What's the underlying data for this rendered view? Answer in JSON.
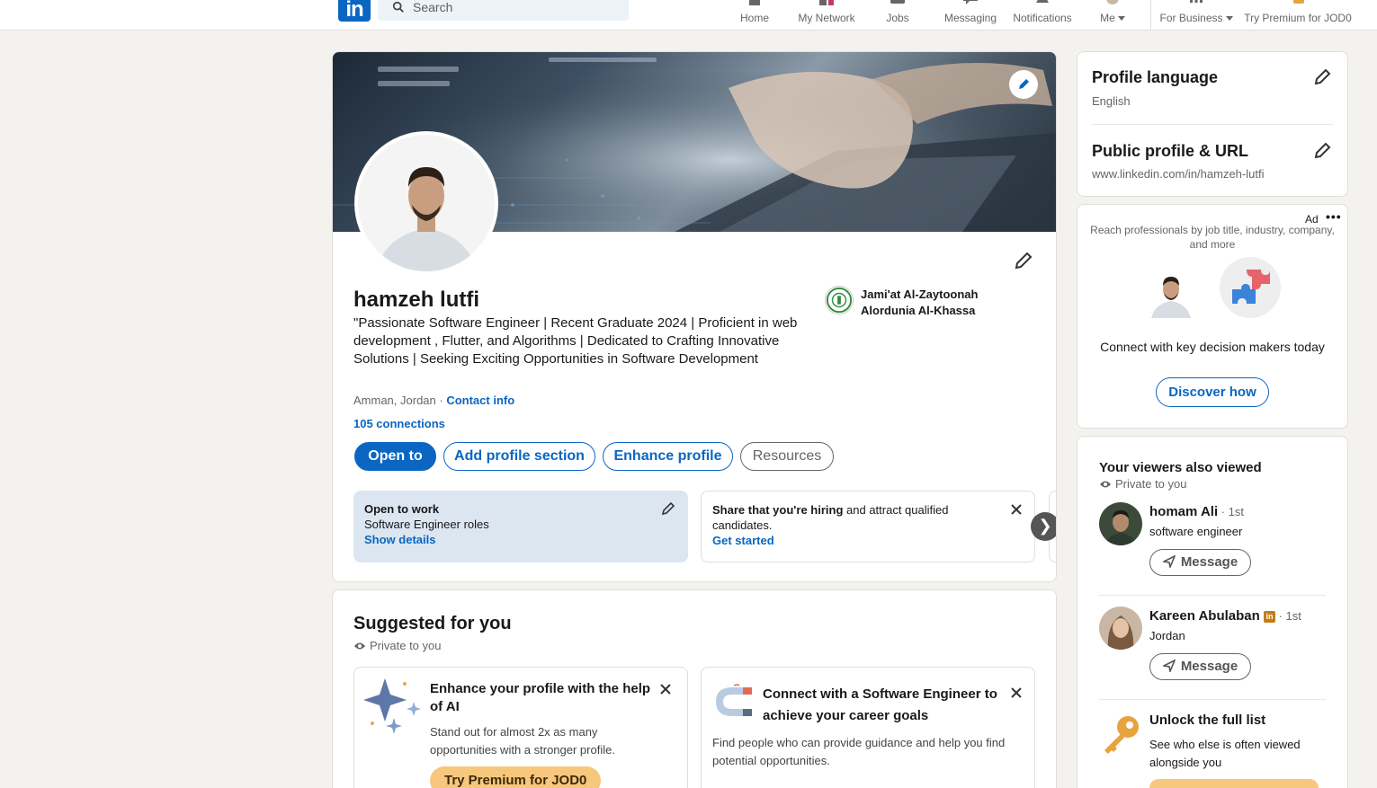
{
  "nav": {
    "search_placeholder": "Search",
    "items": [
      {
        "label": "Home",
        "icon": "home-icon"
      },
      {
        "label": "My Network",
        "icon": "network-icon"
      },
      {
        "label": "Jobs",
        "icon": "jobs-icon"
      },
      {
        "label": "Messaging",
        "icon": "messaging-icon"
      },
      {
        "label": "Notifications",
        "icon": "notifications-icon"
      },
      {
        "label": "Me",
        "icon": "avatar"
      },
      {
        "label": "For Business",
        "icon": "grid-icon"
      },
      {
        "label": "Try Premium for JOD0",
        "icon": "premium-icon"
      }
    ],
    "brand_color": "#0a66c2"
  },
  "profile": {
    "name": "hamzeh lutfi",
    "headline": "\"Passionate Software Engineer | Recent Graduate 2024 | Proficient in web development , Flutter, and Algorithms | Dedicated to Crafting Innovative Solutions | Seeking Exciting Opportunities in Software Development",
    "location": "Amman, Jordan",
    "separator": " · ",
    "contact_info": "Contact info",
    "connections": "105 connections",
    "education": "Jami'at Al-Zaytoonah Alordunia Al-Khassa",
    "buttons": {
      "open_to": "Open to",
      "add_section": "Add profile section",
      "enhance": "Enhance profile",
      "resources": "Resources"
    },
    "open_to_work": {
      "title": "Open to work",
      "roles": "Software Engineer roles",
      "link": "Show details"
    },
    "hiring": {
      "bold": "Share that you're hiring",
      "rest": " and attract qualified candidates.",
      "link": "Get started"
    },
    "next_glyph": "❯"
  },
  "suggested": {
    "title": "Suggested for you",
    "private": "Private to you",
    "cards": [
      {
        "title": "Enhance your profile with the help of AI",
        "desc": "Stand out for almost 2x as many opportunities with a stronger profile.",
        "button": "Try Premium for JOD0"
      },
      {
        "title": "Connect with a Software Engineer to achieve your career goals",
        "desc": "Find people who can provide guidance and help you find potential opportunities."
      }
    ]
  },
  "sidebar": {
    "profile_language": {
      "title": "Profile language",
      "value": "English"
    },
    "public_profile": {
      "title": "Public profile & URL",
      "value": "www.linkedin.com/in/hamzeh-lutfi"
    },
    "ad": {
      "label": "Ad",
      "dots": "•••",
      "text": "Reach professionals by job title, industry, company, and more",
      "cta_text": "Connect with key decision makers today",
      "button": "Discover how"
    },
    "viewers": {
      "title": "Your viewers also viewed",
      "private": "Private to you",
      "people": [
        {
          "name": "homam Ali",
          "degree": " · 1st",
          "sub": "software engineer",
          "button": "Message"
        },
        {
          "name": "Kareen Abulaban",
          "badge": "in",
          "degree": " · 1st",
          "sub": "Jordan",
          "button": "Message"
        }
      ],
      "unlock": {
        "title": "Unlock the full list",
        "desc": "See who else is often viewed alongside you"
      }
    }
  }
}
